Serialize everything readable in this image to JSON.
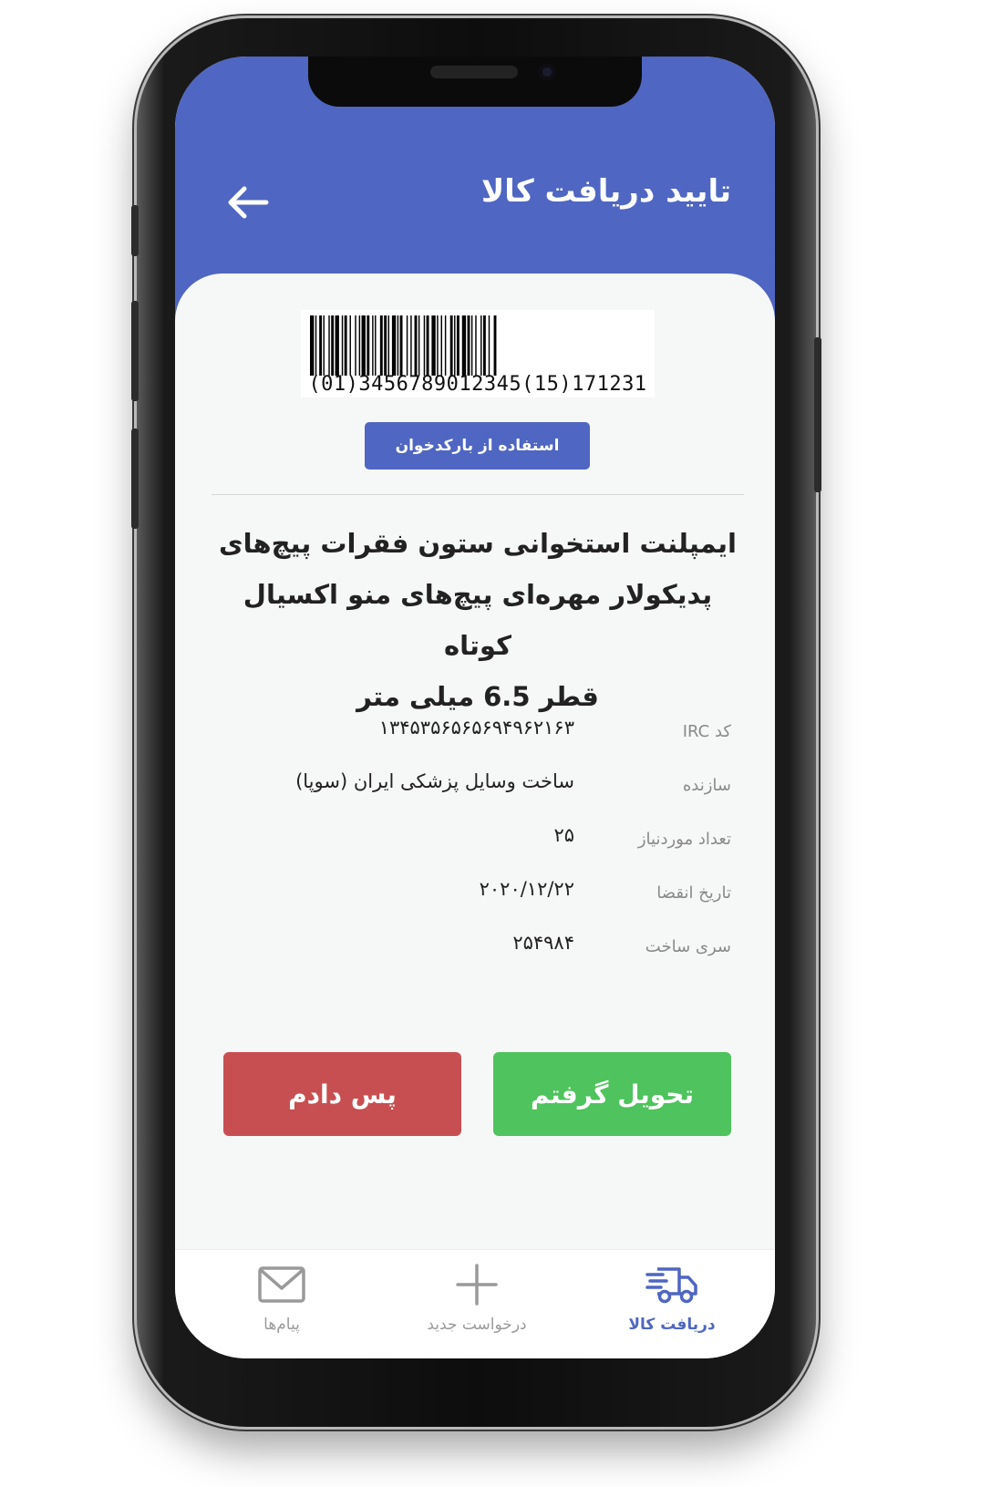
{
  "app": {
    "title": "تایید دریافت کالا",
    "header_color": "#4f66c2"
  },
  "barcode": {
    "text": "(01)3456789012345(15)171231",
    "scan_button_label": "استفاده از بارکدخوان"
  },
  "product": {
    "name_lines": [
      "ایمپلنت استخوانی ستون فقرات پیچ‌های",
      "پدیکولار مهره‌ای پیچ‌های منو اکسیال کوتاه",
      "قطر 6.5 میلی متر"
    ]
  },
  "details": [
    {
      "label": "کد IRC",
      "value": "۱۳۴۵۳۵۶۵۶۵۶۹۴۹۶۲۱۶۳"
    },
    {
      "label": "سازنده",
      "value": "ساخت وسایل پزشکی ایران (سوپا)"
    },
    {
      "label": "تعداد موردنیاز",
      "value": "۲۵"
    },
    {
      "label": "تاریخ انقضا",
      "value": "۲۰۲۰/۱۲/۲۲"
    },
    {
      "label": "سری ساخت",
      "value": "۲۵۴۹۸۴"
    }
  ],
  "actions": {
    "return_label": "پس دادم",
    "receive_label": "تحویل گرفتم",
    "return_color": "#c84f51",
    "receive_color": "#4fc35d"
  },
  "nav": {
    "items": [
      {
        "label": "پیام‌ها",
        "icon": "mail-icon",
        "active": false
      },
      {
        "label": "درخواست جدید",
        "icon": "plus-icon",
        "active": false
      },
      {
        "label": "دریافت کالا",
        "icon": "truck-icon",
        "active": true
      }
    ],
    "active_color": "#4f66c2",
    "inactive_color": "#9a9a9a"
  }
}
